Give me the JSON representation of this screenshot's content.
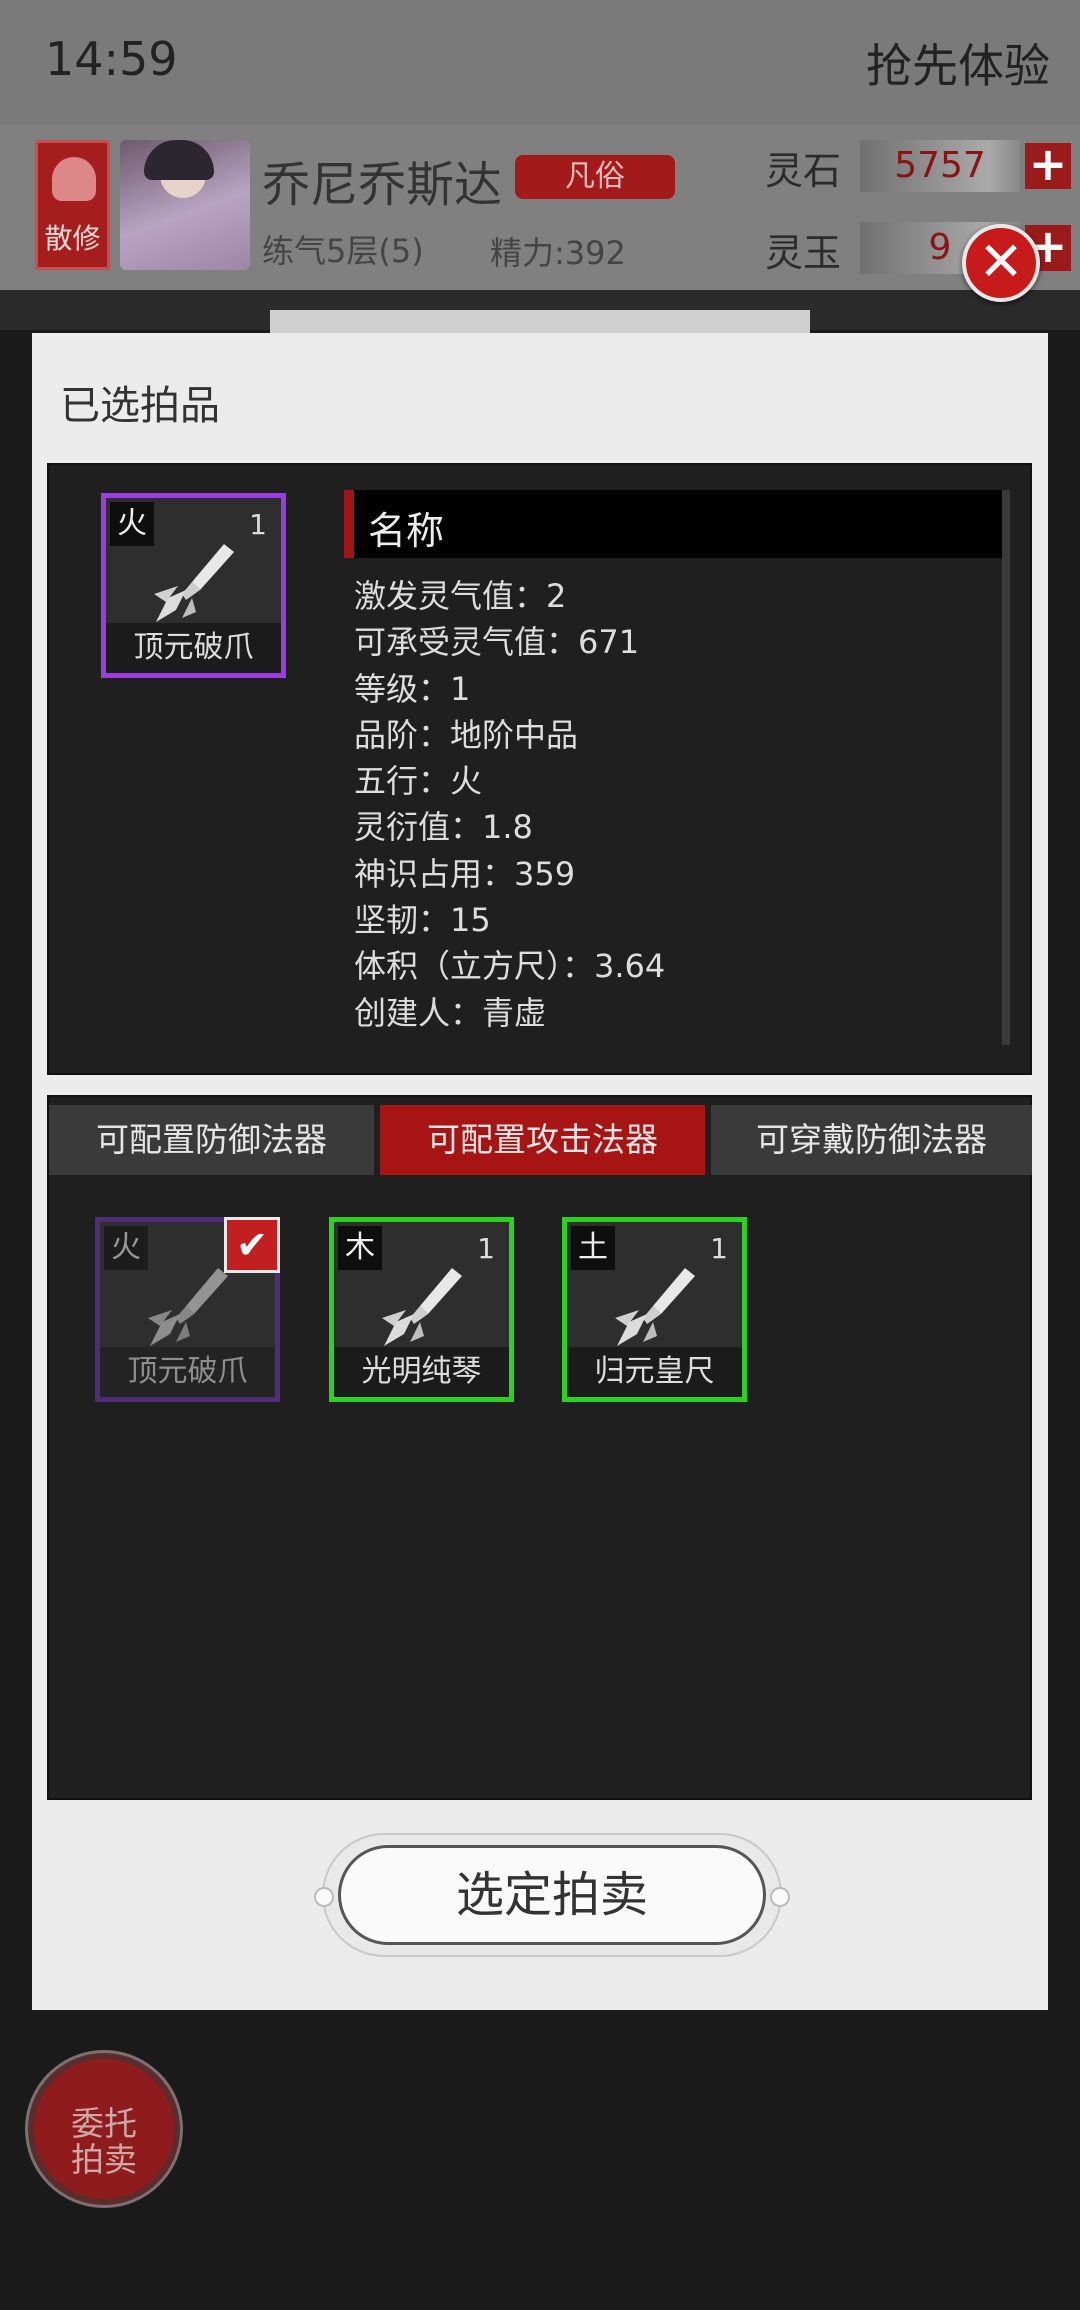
{
  "status_bar": {
    "time": "14:59",
    "right_text": "抢先体验"
  },
  "player": {
    "badge": "散修",
    "name": "乔尼乔斯达",
    "rank": "凡俗",
    "level": "练气5层(5)",
    "energy": "精力:392"
  },
  "currencies": [
    {
      "label": "灵石",
      "value": "5757"
    },
    {
      "label": "灵玉",
      "value": "9"
    }
  ],
  "modal": {
    "title": "已选拍品",
    "selected_item": {
      "element": "火",
      "level": "1",
      "name": "顶元破爪",
      "rarity_color": "#9c3be0"
    },
    "detail": {
      "name_label": "名称",
      "properties": [
        "激发灵气值：2",
        "可承受灵气值：671",
        "等级：1",
        "品阶：地阶中品",
        "五行：火",
        "灵衍值：1.8",
        "神识占用：359",
        "坚韧：15",
        "体积（立方尺）：3.64",
        "创建人：青虚"
      ]
    },
    "tabs": [
      {
        "label": "可配置防御法器",
        "active": false
      },
      {
        "label": "可配置攻击法器",
        "active": true
      },
      {
        "label": "可穿戴防御法器",
        "active": false
      }
    ],
    "items": [
      {
        "element": "火",
        "level": "",
        "name": "顶元破爪",
        "selected": true
      },
      {
        "element": "木",
        "level": "1",
        "name": "光明纯琴",
        "selected": false
      },
      {
        "element": "土",
        "level": "1",
        "name": "归元皇尺",
        "selected": false
      }
    ],
    "confirm_button": "选定拍卖",
    "close_icon": "close-icon"
  },
  "consign_button": {
    "line1": "委托",
    "line2": "拍卖"
  },
  "colors": {
    "accent": "#a61414",
    "rare_purple": "#9c3be0",
    "common_green": "#2ed021"
  }
}
